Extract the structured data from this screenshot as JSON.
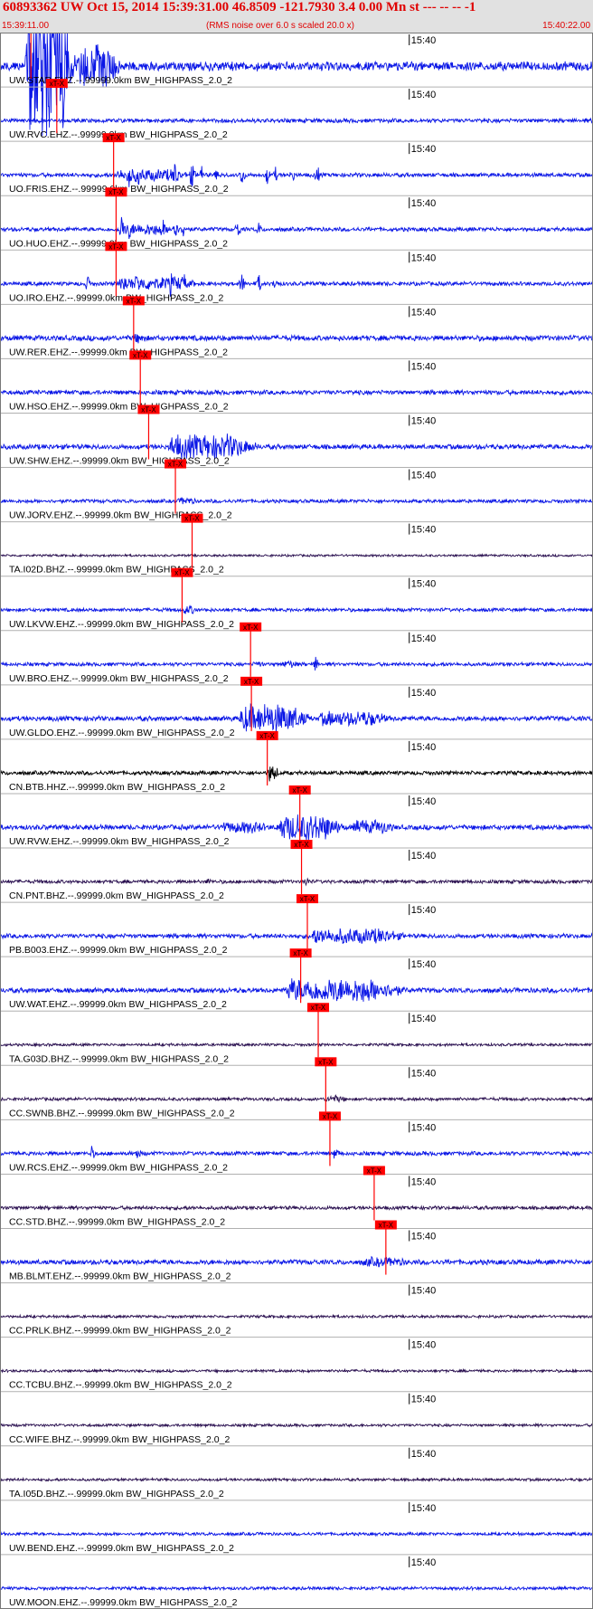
{
  "header": {
    "title": "60893362 UW Oct 15, 2014 15:39:31.00   46.8509 -121.7930  3.4 0.00 Mn st --- -- --  -1",
    "time_start": "15:39:11.00",
    "subtitle": "(RMS noise over 6.0 s scaled 20.0 x)",
    "time_end": "15:40:22.00"
  },
  "colors": {
    "trace_blue": "#0a16e6",
    "trace_dark": "#2a1050",
    "trace_black": "#000000",
    "pick_red": "#ff0000",
    "header_bg": "#e1e1e1"
  },
  "chart_data": {
    "type": "line",
    "title": "60893362 UW Oct 15, 2014 15:39:31.00   46.8509 -121.7930  3.4 0.00 Mn st --- -- --  -1",
    "x_range": [
      "15:39:11.00",
      "15:40:22.00"
    ],
    "minute_tick_label": "15:40",
    "pick_label": "xT-X",
    "series": [
      {
        "label": "UW.STAR.EHZ.--.99999.0km BW_HIGHPASS_2.0_2",
        "color": "blue",
        "pick_s": 3.7,
        "amp": 1.0,
        "segs": [
          [
            3.0,
            9.0,
            22
          ],
          [
            9.0,
            15.0,
            5
          ]
        ],
        "spikes": []
      },
      {
        "label": "UW.RVC.EHZ.--.99999.0km BW_HIGHPASS_2.0_2",
        "color": "blue",
        "pick_s": 6.8,
        "amp": 0.45,
        "segs": [],
        "spikes": []
      },
      {
        "label": "UO.FRIS.EHZ.--.99999.0km BW_HIGHPASS_2.0_2",
        "color": "blue",
        "pick_s": 13.6,
        "amp": 0.45,
        "segs": [
          [
            13.6,
            24.0,
            3
          ]
        ],
        "spikes": [
          [
            15.5,
            9
          ],
          [
            16.5,
            7
          ],
          [
            21.0,
            9
          ],
          [
            23.0,
            7
          ],
          [
            24.0,
            6
          ],
          [
            26.0,
            4
          ],
          [
            29.0,
            6
          ],
          [
            32.0,
            5
          ],
          [
            33.0,
            4
          ],
          [
            35.0,
            4
          ],
          [
            38.0,
            5
          ]
        ]
      },
      {
        "label": "UO.HUO.EHZ.--.99999.0km BW_HIGHPASS_2.0_2",
        "color": "blue",
        "pick_s": 13.9,
        "amp": 0.45,
        "segs": [
          [
            13.9,
            22.0,
            3
          ]
        ],
        "spikes": [
          [
            14.6,
            8
          ],
          [
            15.5,
            6
          ],
          [
            19.5,
            6
          ],
          [
            21.0,
            8
          ],
          [
            22.0,
            5
          ],
          [
            28.5,
            5
          ],
          [
            31.0,
            4
          ]
        ]
      },
      {
        "label": "UO.IRO.EHZ.--.99999.0km BW_HIGHPASS_2.0_2",
        "color": "blue",
        "pick_s": 13.9,
        "amp": 0.45,
        "segs": [
          [
            13.9,
            25.0,
            3.5
          ]
        ],
        "spikes": [
          [
            10.5,
            5
          ],
          [
            14.8,
            8
          ],
          [
            16.5,
            7
          ],
          [
            18.0,
            4
          ],
          [
            20.5,
            8
          ],
          [
            22.0,
            6
          ],
          [
            29.0,
            6
          ],
          [
            31.0,
            5
          ],
          [
            33.0,
            4
          ]
        ]
      },
      {
        "label": "UW.RER.EHZ.--.99999.0km BW_HIGHPASS_2.0_2",
        "color": "blue",
        "pick_s": 16.0,
        "amp": 0.6,
        "segs": [
          [
            15.5,
            18.0,
            2
          ]
        ],
        "spikes": []
      },
      {
        "label": "UW.HSO.EHZ.--.99999.0km BW_HIGHPASS_2.0_2",
        "color": "blue",
        "pick_s": 16.8,
        "amp": 0.5,
        "segs": [],
        "spikes": []
      },
      {
        "label": "UW.SHW.EHZ.--.99999.0km BW_HIGHPASS_2.0_2",
        "color": "blue",
        "pick_s": 17.8,
        "amp": 0.55,
        "segs": [
          [
            20.0,
            32.0,
            5
          ]
        ],
        "spikes": []
      },
      {
        "label": "UW.JORV.EHZ.--.99999.0km BW_HIGHPASS_2.0_2",
        "color": "blue",
        "pick_s": 21.0,
        "amp": 0.4,
        "segs": [
          [
            21.0,
            24.0,
            2.2
          ]
        ],
        "spikes": []
      },
      {
        "label": "TA.I02D.BHZ.--.99999.0km BW_HIGHPASS_2.0_2",
        "color": "dark",
        "pick_s": 23.0,
        "amp": 0.25,
        "segs": [],
        "spikes": []
      },
      {
        "label": "UW.LKVW.EHZ.--.99999.0km BW_HIGHPASS_2.0_2",
        "color": "blue",
        "pick_s": 21.8,
        "amp": 0.4,
        "segs": [
          [
            21.5,
            24.0,
            2.5
          ]
        ],
        "spikes": []
      },
      {
        "label": "UW.BRO.EHZ.--.99999.0km BW_HIGHPASS_2.0_2",
        "color": "blue",
        "pick_s": 30.0,
        "amp": 0.4,
        "segs": [
          [
            30.0,
            32.0,
            2
          ],
          [
            33.5,
            36.0,
            2.5
          ]
        ],
        "spikes": [
          [
            37.8,
            5
          ]
        ]
      },
      {
        "label": "UW.GLDO.EHZ.--.99999.0km BW_HIGHPASS_2.0_2",
        "color": "blue",
        "pick_s": 30.1,
        "amp": 0.55,
        "segs": [
          [
            28.5,
            38.0,
            6
          ],
          [
            38.0,
            48.0,
            3
          ]
        ],
        "spikes": []
      },
      {
        "label": "CN.BTB.HHZ.--.99999.0km BW_HIGHPASS_2.0_2",
        "color": "black",
        "pick_s": 32.0,
        "amp": 0.45,
        "segs": [
          [
            31.8,
            33.5,
            6
          ]
        ],
        "spikes": []
      },
      {
        "label": "UW.RVW.EHZ.--.99999.0km BW_HIGHPASS_2.0_2",
        "color": "blue",
        "pick_s": 35.9,
        "amp": 0.55,
        "segs": [
          [
            26.0,
            33.0,
            2.5
          ],
          [
            33.0,
            42.0,
            5.5
          ],
          [
            42.0,
            48.0,
            3
          ]
        ],
        "spikes": []
      },
      {
        "label": "CN.PNT.BHZ.--.99999.0km BW_HIGHPASS_2.0_2",
        "color": "dark",
        "pick_s": 36.1,
        "amp": 0.4,
        "segs": [
          [
            36.0,
            37.5,
            3
          ]
        ],
        "spikes": [
          [
            25.0,
            3
          ]
        ]
      },
      {
        "label": "PB.B003.EHZ.--.99999.0km BW_HIGHPASS_2.0_2",
        "color": "blue",
        "pick_s": 36.8,
        "amp": 0.5,
        "segs": [
          [
            37.0,
            50.0,
            3.5
          ]
        ],
        "spikes": []
      },
      {
        "label": "UW.WAT.EHZ.--.99999.0km BW_HIGHPASS_2.0_2",
        "color": "blue",
        "pick_s": 36.0,
        "amp": 0.55,
        "segs": [
          [
            34.0,
            50.0,
            5
          ]
        ],
        "spikes": []
      },
      {
        "label": "TA.G03D.BHZ.--.99999.0km BW_HIGHPASS_2.0_2",
        "color": "dark",
        "pick_s": 38.1,
        "amp": 0.3,
        "segs": [],
        "spikes": []
      },
      {
        "label": "CC.SWNB.BHZ.--.99999.0km BW_HIGHPASS_2.0_2",
        "color": "dark",
        "pick_s": 39.0,
        "amp": 0.35,
        "segs": [
          [
            38.5,
            42.0,
            2.5
          ]
        ],
        "spikes": []
      },
      {
        "label": "UW.RCS.EHZ.--.99999.0km BW_HIGHPASS_2.0_2",
        "color": "blue",
        "pick_s": 39.5,
        "amp": 0.45,
        "segs": [
          [
            39.5,
            41.0,
            3
          ]
        ],
        "spikes": [
          [
            11.0,
            4
          ],
          [
            16.5,
            4
          ]
        ]
      },
      {
        "label": "CC.STD.BHZ.--.99999.0km BW_HIGHPASS_2.0_2",
        "color": "dark",
        "pick_s": 44.8,
        "amp": 0.4,
        "segs": [],
        "spikes": []
      },
      {
        "label": "MB.BLMT.EHZ.--.99999.0km BW_HIGHPASS_2.0_2",
        "color": "blue",
        "pick_s": 46.2,
        "amp": 0.55,
        "segs": [
          [
            43.0,
            50.0,
            2
          ]
        ],
        "spikes": []
      },
      {
        "label": "CC.PRLK.BHZ.--.99999.0km BW_HIGHPASS_2.0_2",
        "color": "dark",
        "pick_s": null,
        "amp": 0.3,
        "segs": [],
        "spikes": []
      },
      {
        "label": "CC.TCBU.BHZ.--.99999.0km BW_HIGHPASS_2.0_2",
        "color": "dark",
        "pick_s": null,
        "amp": 0.3,
        "segs": [],
        "spikes": []
      },
      {
        "label": "CC.WIFE.BHZ.--.99999.0km BW_HIGHPASS_2.0_2",
        "color": "dark",
        "pick_s": null,
        "amp": 0.3,
        "segs": [],
        "spikes": []
      },
      {
        "label": "TA.I05D.BHZ.--.99999.0km BW_HIGHPASS_2.0_2",
        "color": "dark",
        "pick_s": null,
        "amp": 0.3,
        "segs": [],
        "spikes": []
      },
      {
        "label": "UW.BEND.EHZ.--.99999.0km BW_HIGHPASS_2.0_2",
        "color": "blue",
        "pick_s": null,
        "amp": 0.35,
        "segs": [],
        "spikes": []
      },
      {
        "label": "UW.MOON.EHZ.--.99999.0km BW_HIGHPASS_2.0_2",
        "color": "blue",
        "pick_s": null,
        "amp": 0.35,
        "segs": [],
        "spikes": []
      }
    ]
  }
}
